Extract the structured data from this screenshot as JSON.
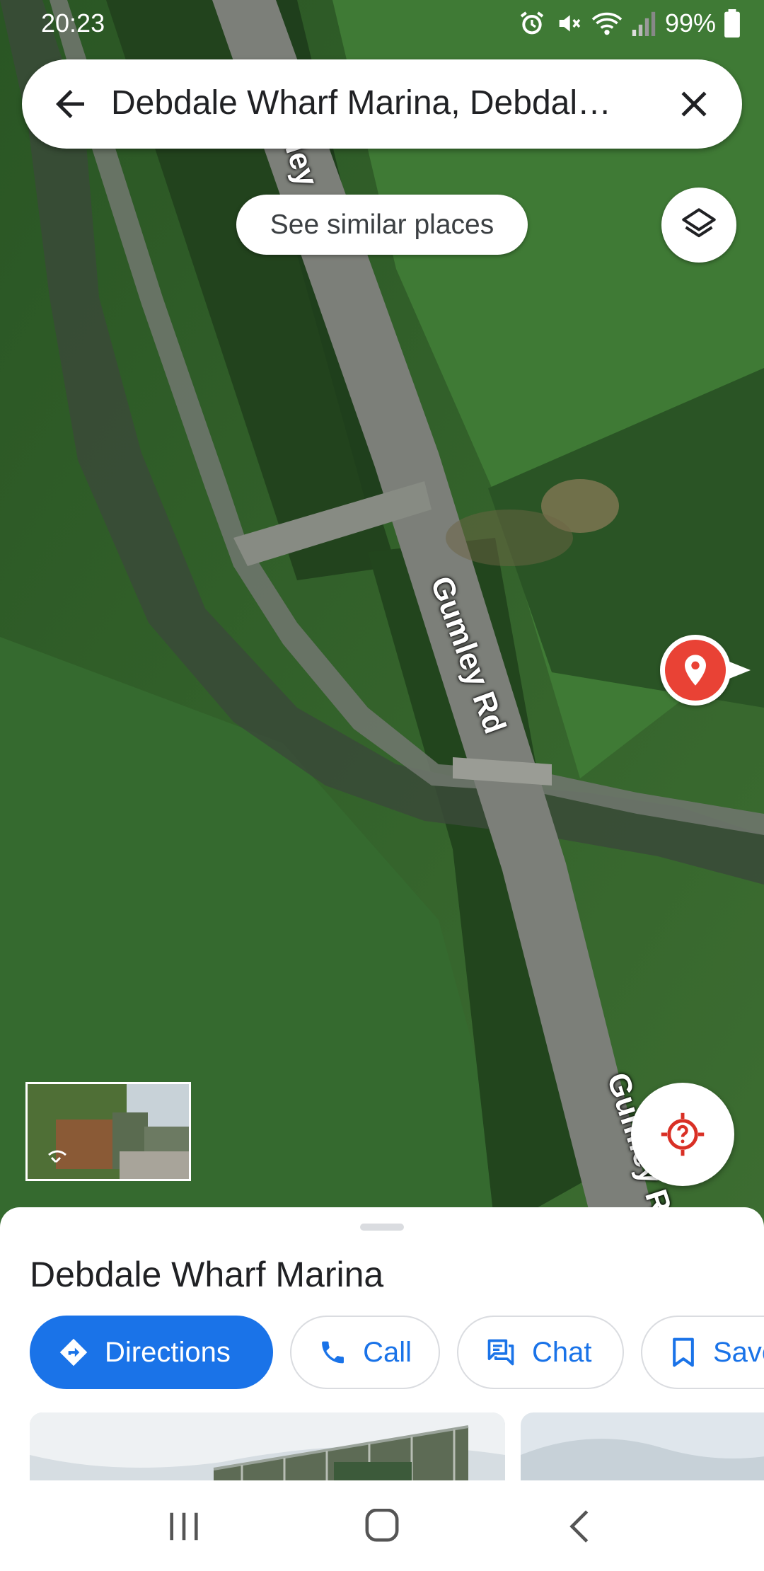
{
  "status_bar": {
    "time": "20:23",
    "battery": "99%",
    "icons": [
      "alarm-icon",
      "mute-icon",
      "wifi-icon",
      "signal-icon",
      "battery-icon"
    ]
  },
  "search": {
    "query": "Debdale Wharf Marina, Debdal…",
    "back_icon": "arrow-back-icon",
    "close_icon": "close-icon"
  },
  "map": {
    "see_similar_label": "See similar places",
    "roads": [
      "Gumley Rd",
      "Gumley R",
      "ley"
    ],
    "layers_icon": "layers-icon",
    "locate_icon": "locate-question-icon",
    "pin_icon": "place-pin-icon"
  },
  "place": {
    "name": "Debdale Wharf Marina",
    "actions": [
      {
        "label": "Directions",
        "icon": "directions-icon"
      },
      {
        "label": "Call",
        "icon": "phone-icon"
      },
      {
        "label": "Chat",
        "icon": "chat-icon"
      },
      {
        "label": "Save",
        "icon": "bookmark-icon"
      }
    ]
  },
  "colors": {
    "accent": "#1a73e8",
    "pin": "#e94235",
    "grass": "#2f5a2a"
  }
}
